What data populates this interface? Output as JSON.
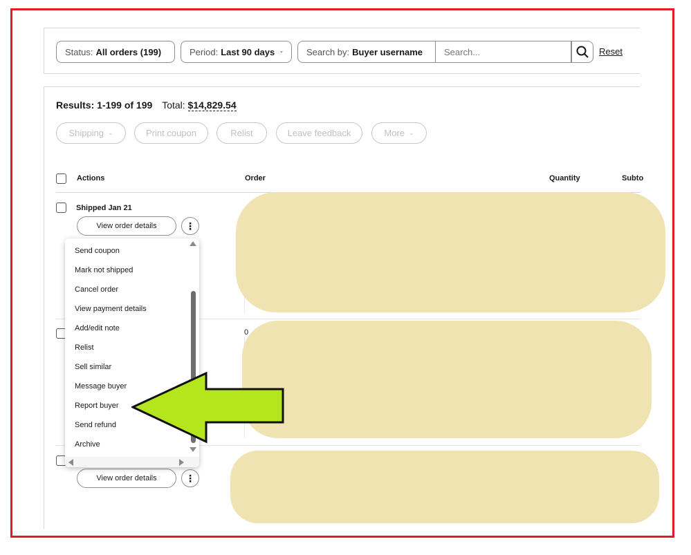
{
  "filters": {
    "status_label": "Status:",
    "status_value": "All orders (199)",
    "period_label": "Period:",
    "period_value": "Last 90 days",
    "searchby_label": "Search by:",
    "searchby_value": "Buyer username",
    "search_placeholder": "Search...",
    "reset": "Reset"
  },
  "results": {
    "range_label": "Results: 1-199 of 199",
    "total_label": "Total:",
    "total_value": "$14,829.54"
  },
  "bulk_actions": [
    "Shipping",
    "Print coupon",
    "Relist",
    "Leave feedback",
    "More"
  ],
  "columns": {
    "actions": "Actions",
    "order": "Order",
    "quantity": "Quantity",
    "subtotal": "Subto"
  },
  "rows": [
    {
      "status": "Shipped Jan 21",
      "button": "View order details"
    },
    {
      "status": "",
      "order_fragment": "0"
    },
    {
      "status": "",
      "button": "View order details"
    }
  ],
  "menu_items": [
    "Send coupon",
    "Mark not shipped",
    "Cancel order",
    "View payment details",
    "Add/edit note",
    "Relist",
    "Sell similar",
    "Message buyer",
    "Report buyer",
    "Send refund",
    "Archive"
  ],
  "colors": {
    "frame": "#e21b2a",
    "arrow_fill": "#b5e61d",
    "redaction": "#efe3b2"
  }
}
